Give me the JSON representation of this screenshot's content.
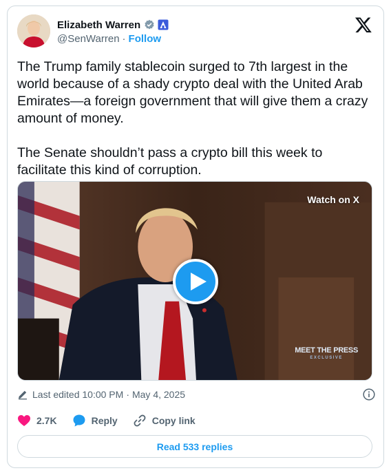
{
  "author": {
    "name": "Elizabeth Warren",
    "handle": "@SenWarren",
    "separator": "·",
    "follow_label": "Follow"
  },
  "icons": {
    "verified": "verified-badge-icon",
    "government": "government-badge-icon",
    "logo": "x-logo-icon",
    "edit": "pencil-icon",
    "info": "info-icon",
    "like": "heart-icon",
    "reply": "reply-bubble-icon",
    "copy": "link-icon",
    "play": "play-icon"
  },
  "tweet": {
    "text": "The Trump family stablecoin surged to 7th largest in the world because of a shady crypto deal with the United Arab Emirates—a foreign government that will give them a crazy amount of money.\n\nThe Senate shouldn’t pass a crypto bill this week to facilitate this kind of corruption."
  },
  "video": {
    "watch_label": "Watch on X",
    "watermark_title": "MEET THE PRESS",
    "watermark_sub": "EXCLUSIVE"
  },
  "meta": {
    "edited": "Last edited 10:00 PM",
    "separator": "·",
    "date": "May 4, 2025"
  },
  "actions": {
    "likes": "2.7K",
    "reply_label": "Reply",
    "copy_label": "Copy link"
  },
  "read_replies_label": "Read 533 replies",
  "colors": {
    "accent": "#1d9bf0",
    "like": "#f91880",
    "text": "#0f1419",
    "secondary": "#536471",
    "border": "#cfd9de"
  }
}
